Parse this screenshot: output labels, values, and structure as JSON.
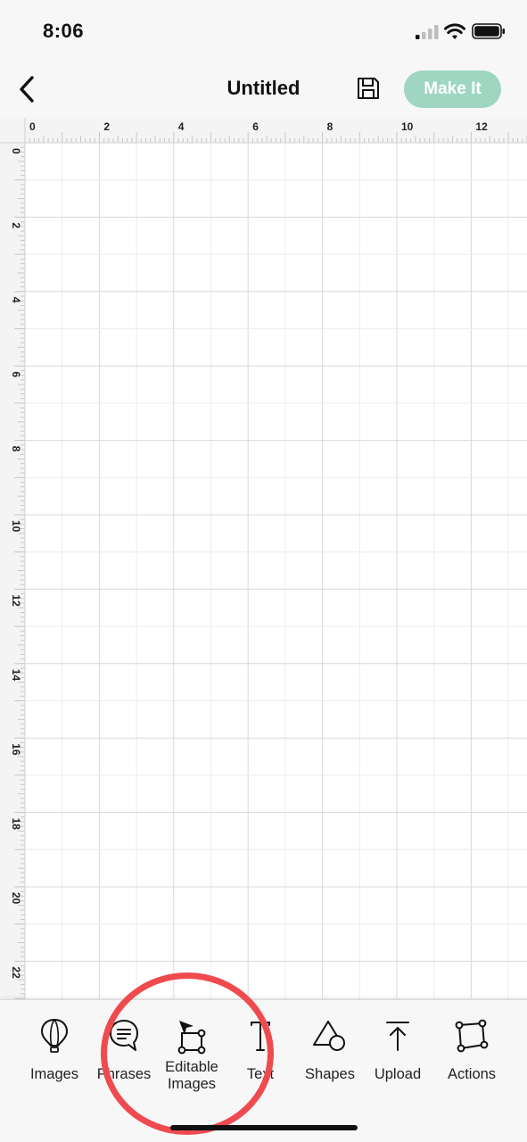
{
  "status_bar": {
    "time": "8:06",
    "signal_icon": "cellular-signal-icon",
    "wifi_icon": "wifi-icon",
    "battery_icon": "battery-icon"
  },
  "header": {
    "title": "Untitled",
    "back_icon": "chevron-left-icon",
    "save_icon": "floppy-disk-icon",
    "make_it_label": "Make It",
    "make_it_color": "#9ed6c1"
  },
  "canvas": {
    "top_ruler_labels": [
      "0",
      "2",
      "4",
      "6",
      "8",
      "10",
      "12"
    ],
    "left_ruler_labels": [
      "0",
      "2",
      "4",
      "6",
      "8",
      "10",
      "12",
      "14",
      "16",
      "18",
      "20",
      "22"
    ]
  },
  "toolbar": {
    "items": [
      {
        "label": "Images",
        "icon": "hot-air-balloon-icon"
      },
      {
        "label": "Phrases",
        "icon": "speech-bubble-icon"
      },
      {
        "label": "Editable Images",
        "label_line1": "Editable",
        "label_line2": "Images",
        "icon": "editable-image-icon"
      },
      {
        "label": "Text",
        "icon": "text-icon"
      },
      {
        "label": "Shapes",
        "icon": "shapes-icon"
      },
      {
        "label": "Upload",
        "icon": "upload-icon"
      },
      {
        "label": "Actions",
        "icon": "actions-icon"
      }
    ],
    "highlight_color": "#ef4b4f"
  }
}
